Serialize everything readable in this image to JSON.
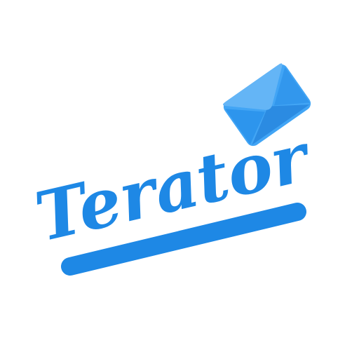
{
  "logo": {
    "wordmark": "Terator",
    "icon": "envelope-icon"
  },
  "colors": {
    "background": "#ffffff",
    "primary_blue": "#1e88e5",
    "envelope_light": "#64b5f6",
    "envelope_mid": "#42a5f5",
    "envelope_dark": "#1976d2"
  }
}
